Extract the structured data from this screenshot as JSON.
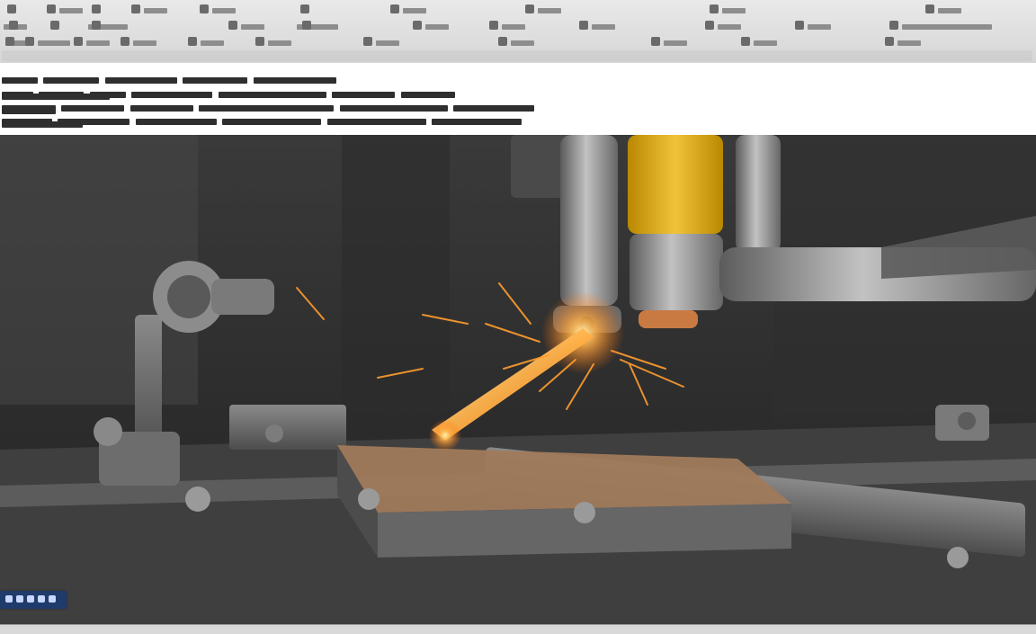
{
  "header_text": {
    "line1": "",
    "line2": "",
    "line3": "",
    "line4": ""
  },
  "image": {
    "alt": "",
    "palette": {
      "background_dark": "#2d2d2d",
      "metal_light": "#b7b7b7",
      "metal_mid": "#8c8c8c",
      "metal_dark": "#555555",
      "yellow_cylinder": "#e4b21f",
      "spark": "#ff9d2d",
      "spark_core": "#fff2b0",
      "rust": "#6b4b34"
    },
    "icons": [
      "welding-torch-icon",
      "drill-press-icon",
      "spark-icon"
    ]
  },
  "ui": {
    "toolbar_rows": 4,
    "mini_toolbar": [
      "mini-icon-1",
      "mini-icon-2",
      "mini-icon-3",
      "mini-icon-4",
      "mini-icon-5"
    ]
  }
}
